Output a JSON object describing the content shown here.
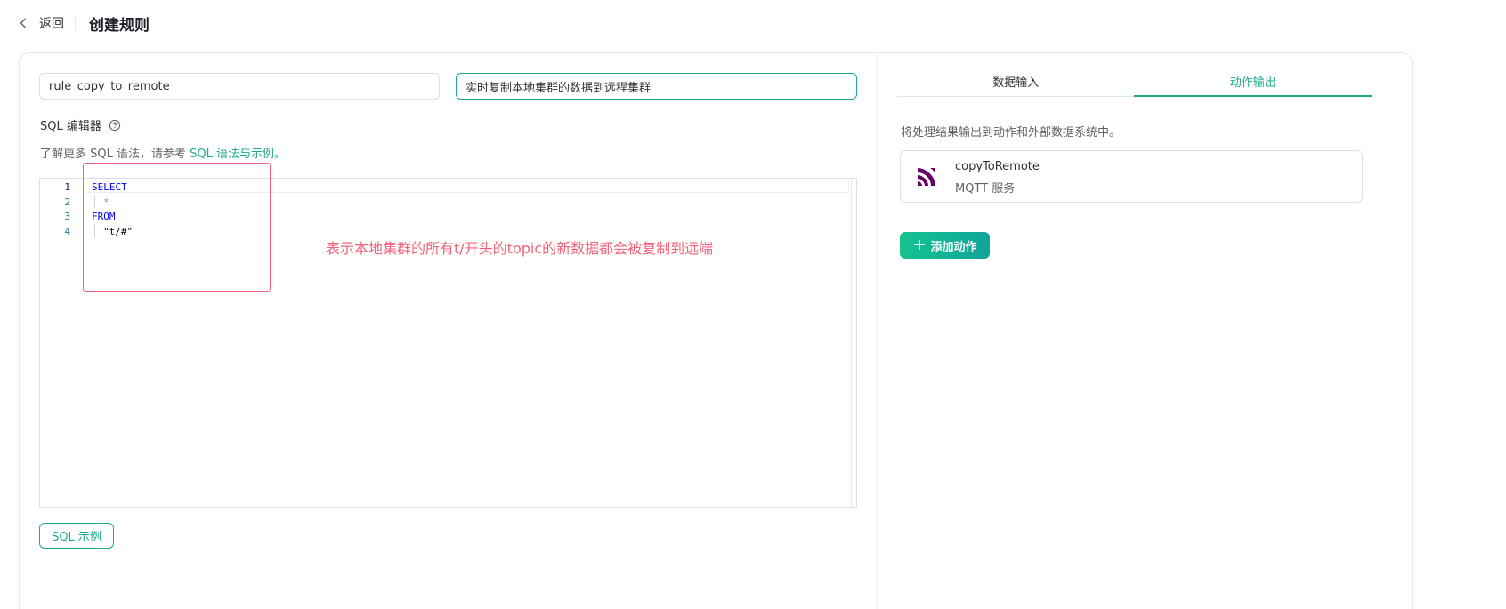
{
  "topbar": {
    "back_label": "返回",
    "title": "创建规则"
  },
  "form": {
    "rule_name_value": "rule_copy_to_remote",
    "description_value": "实时复制本地集群的数据到远程集群",
    "sql_editor_label": "SQL 编辑器",
    "hint_prefix": "了解更多 SQL 语法，请参考",
    "hint_link": "SQL 语法与示例。"
  },
  "editor": {
    "line_numbers": [
      "1",
      "2",
      "3",
      "4"
    ],
    "lines": [
      {
        "text": "SELECT",
        "kind": "keyword"
      },
      {
        "text": "*",
        "kind": "operator"
      },
      {
        "text": "FROM",
        "kind": "keyword"
      },
      {
        "text": "\"t/#\"",
        "kind": "string"
      }
    ]
  },
  "annotation": {
    "text": "表示本地集群的所有t/开头的topic的新数据都会被复制到远端",
    "color": "#f2627c"
  },
  "sql_example_button": "SQL 示例",
  "tabs": [
    {
      "label": "数据输入",
      "active": false
    },
    {
      "label": "动作输出",
      "active": true
    }
  ],
  "output": {
    "description": "将处理结果输出到动作和外部数据系统中。",
    "action": {
      "name": "copyToRemote",
      "type": "MQTT 服务",
      "icon": "mqtt-icon",
      "icon_color": "#660066"
    },
    "add_action_label": "添加动作"
  },
  "colors": {
    "accent": "#1ea98c",
    "annotation": "#f2627c"
  }
}
